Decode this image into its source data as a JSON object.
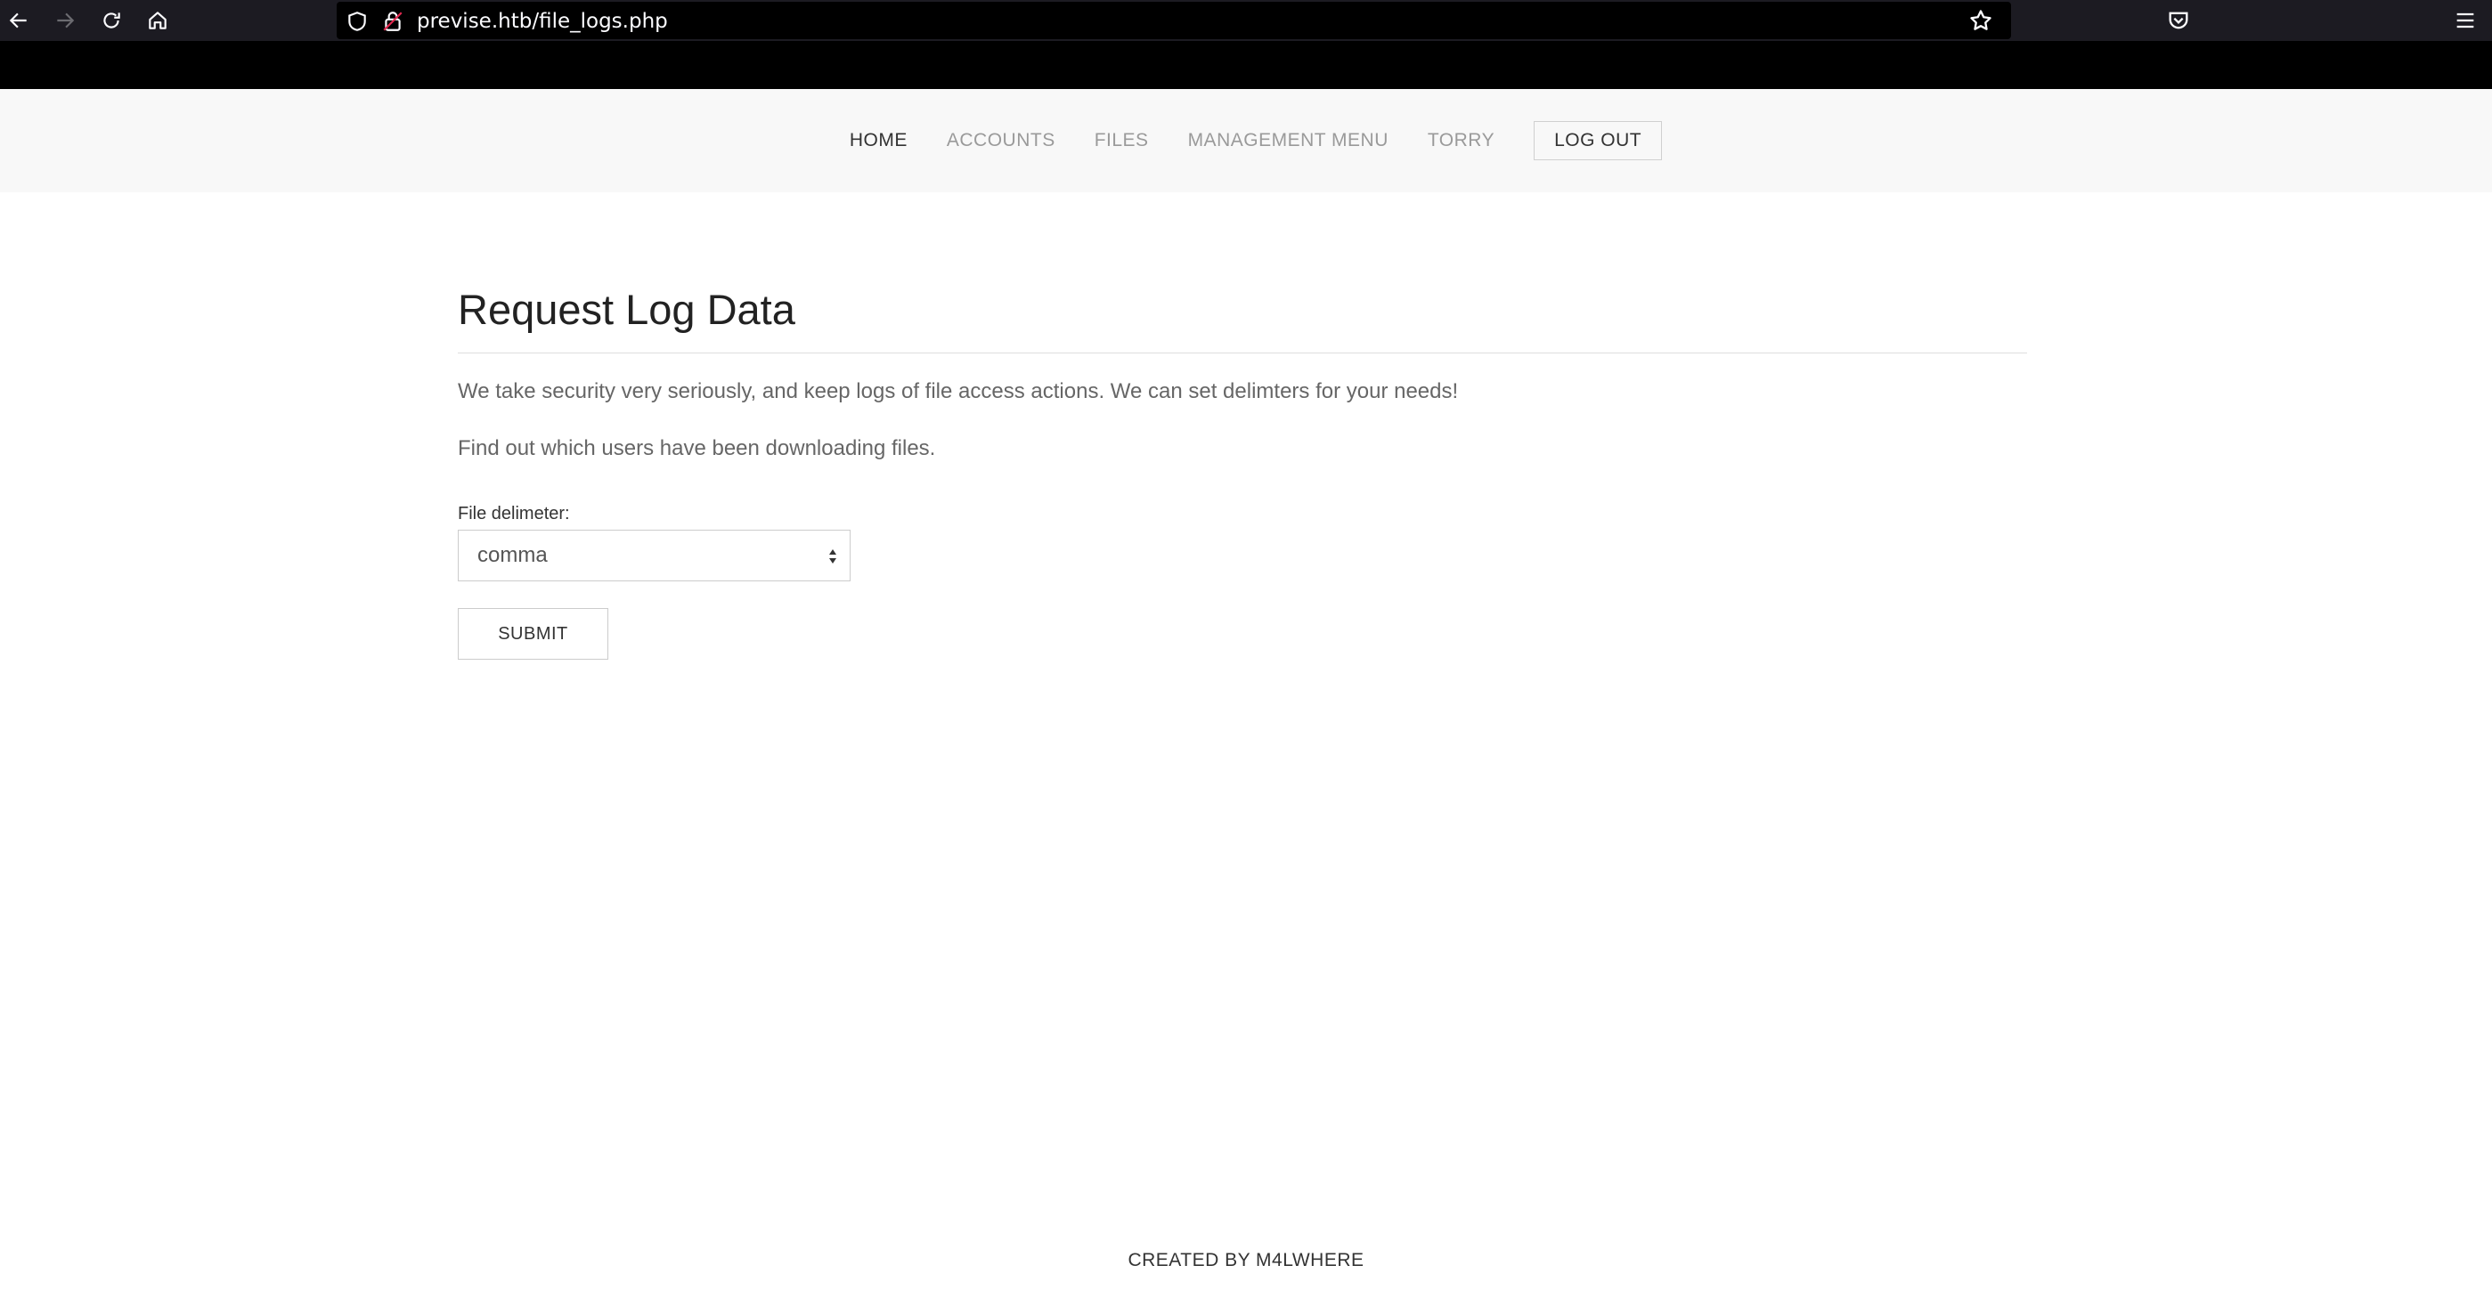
{
  "browser": {
    "url": "previse.htb/file_logs.php",
    "icons": {
      "back": "arrow-left-icon",
      "forward": "arrow-right-icon",
      "reload": "reload-icon",
      "home": "home-icon",
      "shield": "shield-icon",
      "lock": "lock-icon",
      "bookmark": "star-icon",
      "pocket": "pocket-icon",
      "menu": "hamburger-menu-icon"
    }
  },
  "nav": {
    "items": [
      {
        "label": "HOME",
        "active": true
      },
      {
        "label": "ACCOUNTS",
        "active": false
      },
      {
        "label": "FILES",
        "active": false
      },
      {
        "label": "MANAGEMENT MENU",
        "active": false
      },
      {
        "label": "TORRY",
        "active": false
      }
    ],
    "logout_label": "LOG OUT"
  },
  "main": {
    "title": "Request Log Data",
    "intro": "We take security very seriously, and keep logs of file access actions. We can set delimters for your needs!",
    "sub": "Find out which users have been downloading files.",
    "delimiter_label": "File delimeter:",
    "delimiter_value": "comma",
    "submit_label": "SUBMIT"
  },
  "footer": {
    "text": "CREATED BY M4LWHERE"
  },
  "colors": {
    "chrome": "#000000",
    "header_bg": "#f8f8f8",
    "nav_inactive": "#9a9a9a",
    "nav_active": "#333333"
  }
}
